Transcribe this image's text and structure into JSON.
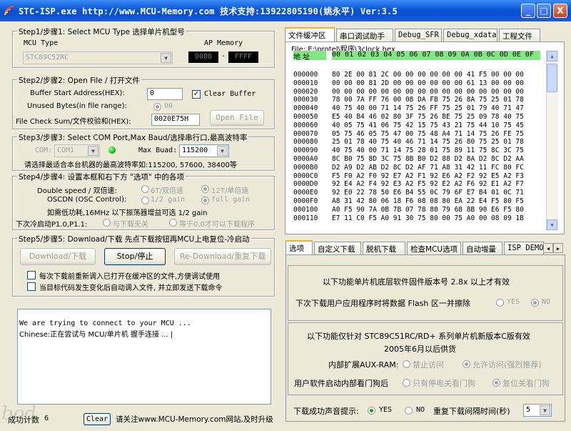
{
  "window": {
    "title": "STC-ISP.exe http://www.MCU-Memory.com 技术支持:13922805190(姚永平) Ver:3.5",
    "min_label": "_",
    "max_label": "□",
    "close_label": "X"
  },
  "step1": {
    "title": "Step1/步骤1: Select MCU Type  选择单片机型号",
    "mcu_type_label": "MCU Type",
    "mcu_value": "STC89C52RC",
    "ap_memory_label": "AP Memory",
    "ap_start": "0000",
    "ap_end": "FFFF"
  },
  "step2": {
    "title": "Step2/步骤2: Open File / 打开文件",
    "buffer_label": "Buffer Start Address(HEX):",
    "buffer_value": "0",
    "clear_buffer_label": "Clear Buffer",
    "unused_label": "Unused Bytes(in file range):",
    "unused_value": "00",
    "checksum_label": "File Check Sum/文件校验和(HEX):",
    "checksum_value": "0020E75H",
    "open_file_label": "Open File"
  },
  "step3": {
    "title": "Step3/步骤3: Select COM Port,Max Baud/选择串行口,最高波特率",
    "com_label": "COM:",
    "com_value": "COM1",
    "baud_label": "Max Buad:",
    "baud_value": "115200",
    "note": "请选择最适合本台机器的最高波特率如:115200, 57600, 38400等"
  },
  "step4": {
    "title": "Step4/步骤4: 设置本框和右下方 \"选项\" 中的各项",
    "double_speed_label": "Double speed / 双倍速:",
    "opt_6t": "6T/双倍速",
    "opt_12t": "12T/单倍速",
    "oscdn_label": "OSCDN (OSC Control):",
    "opt_half": "1/2 gain",
    "opt_full": "full gain",
    "low_power_note": "如需低功耗,16MHz 以下振荡器增益可选 1/2 gain",
    "cold_start_label": "下次冷启动P1.0,P1.1:",
    "opt_unrelated": "与下载无关",
    "opt_equal0": "等于0,0才可以下载程序"
  },
  "step5": {
    "title": "Step5/步骤5: Download/下载  先点下载按钮再MCU上电复位-冷启动",
    "download_label": "Download/下载",
    "stop_label": "Stop/停止",
    "redownload_label": "Re-Download/重复下载",
    "check1_label": "每次下载前重新调入已打开在缓冲区的文件,方便调试使用",
    "check2_label": "当目标代码发生变化后自动调入文件, 并立即发送下载命令"
  },
  "log": {
    "line1": "We are trying to connect to your MCU ...",
    "line2": "Chinese:正在尝试与 MCU/单片机 握手连接 ... |"
  },
  "statusbar": {
    "success_label": "成功计数",
    "success_count": "6",
    "clear_label": "Clear",
    "message": "请关注www.MCU-Memory.com网站,及时升级"
  },
  "upper_tabs": [
    "文件缓冲区",
    "串口调试助手",
    "Debug_SFR",
    "Debug_xdata",
    "工程文件"
  ],
  "file_label": "File: E:\\protel\\程序\\3clock.hex",
  "hex": {
    "header_label": "地 址",
    "header_cols": "00 01 02 03 04 05 06 07 08 09 0A 0B 0C 0D 0E 0F",
    "rows": [
      [
        "000000",
        "80 2E 00 81 2C 00 00 00 00 00 00 41 F5 00 00 00"
      ],
      [
        "000010",
        "00 00 00 81 2D 00 00 00 00 00 00 61 13 00 00 00"
      ],
      [
        "000020",
        "00 00 00 00 00 00 00 00 00 00 00 00 00 00 00 00"
      ],
      [
        "000030",
        "78 00 7A FF 76 00 08 DA FB 75 26 8A 75 25 01 78"
      ],
      [
        "000040",
        "40 75 40 00 71 14 75 26 FF 75 25 01 79 40 71 47"
      ],
      [
        "000050",
        "E5 40 B4 46 02 80 3F 75 26 BE 75 25 09 78 40 75"
      ],
      [
        "000060",
        "40 05 75 41 06 75 42 15 75 43 21 75 44 10 75 45"
      ],
      [
        "000070",
        "05 75 46 05 75 47 00 75 48 A4 71 14 75 26 FE 75"
      ],
      [
        "000080",
        "25 01 78 40 75 40 46 71 14 75 26 80 75 25 01 78"
      ],
      [
        "000090",
        "40 75 40 00 71 14 75 28 01 75 89 11 75 8C 3C 75"
      ],
      [
        "0000A0",
        "8C B0 75 8D 3C 75 8B B0 D2 88 D2 8A D2 8C D2 AA"
      ],
      [
        "0000B0",
        "D2 A9 D2 AB D2 8C D2 AF 71 A8 31 42 11 FC 80 FC"
      ],
      [
        "0000C0",
        "F5 F0 A2 F0 92 E7 A2 F1 92 E6 A2 F2 92 E5 A2 F3"
      ],
      [
        "0000D0",
        "92 E4 A2 F4 92 E3 A2 F5 92 E2 A2 F6 92 E1 A2 F7"
      ],
      [
        "0000E0",
        "92 E0 22 78 50 E6 B4 55 0C 79 6F E7 B4 01 0C 71"
      ],
      [
        "0000F0",
        "A8 31 42 80 06 18 F6 08 08 80 EA 22 E4 F5 80 F5"
      ],
      [
        "000100",
        "A0 F5 90 7A 0B 7B 07 78 80 79 68 8B 90 E6 F5 80"
      ],
      [
        "000110",
        "E7 11 C0 F5 A0 91 30 75 80 00 75 A0 00 08 09 1B"
      ]
    ]
  },
  "lower_tabs": [
    "选项",
    "自定义下载",
    "脱机下载",
    "检查MCU选项",
    "自动增量",
    "ISP DEMO"
  ],
  "options": {
    "note1": "以下功能单片机底层软件固件版本号 2.8x 以上才有效",
    "flash_label": "下次下载用户应用程序时将数据 Flash 区一并擦除",
    "flash_yes": "YES",
    "flash_no": "NO",
    "note2": "以下功能仅针对 STC89C51RC/RD+ 系列单片机新版本C版有效",
    "note3": "2005年6月以后供货",
    "auxram_label": "内部扩展AUX-RAM:",
    "auxram_opt1": "禁止访问",
    "auxram_opt2": "允许访问(强烈推荐)",
    "watchdog_label": "用户软件启动内部看门狗后",
    "wd_opt1": "只有停电关看门狗",
    "wd_opt2": "复位关看门狗",
    "sound_label": "下载成功声音提示:",
    "sound_yes": "YES",
    "sound_no": "NO",
    "repeat_label": "重复下载间隔时间(秒)",
    "repeat_value": "5"
  },
  "scroll": {
    "up": "▲",
    "down": "▼",
    "left": "◀",
    "right": "▶"
  },
  "watermark": "bod"
}
